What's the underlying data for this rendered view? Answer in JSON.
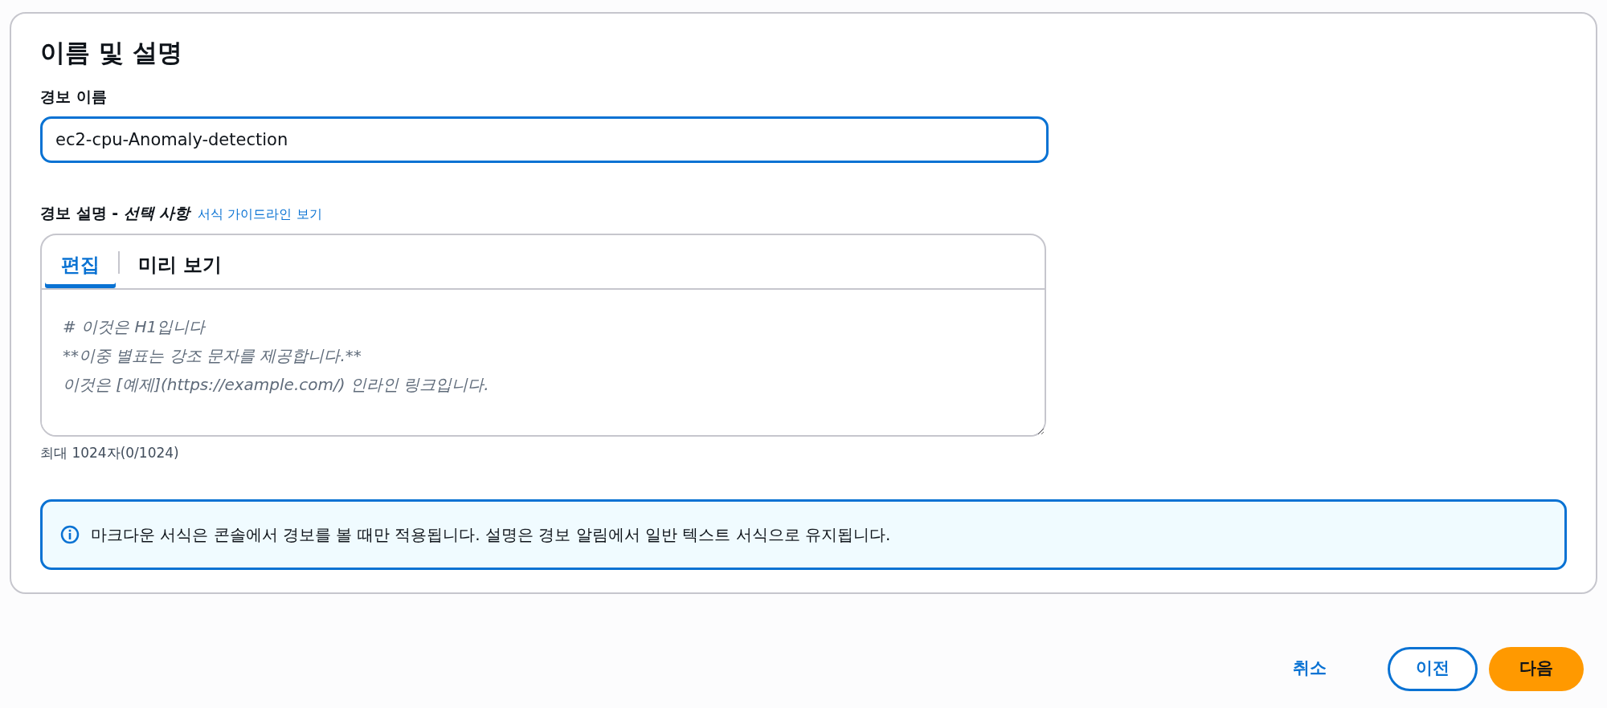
{
  "panel": {
    "title": "이름 및 설명"
  },
  "alarm_name": {
    "label": "경보 이름",
    "value": "ec2-cpu-Anomaly-detection"
  },
  "alarm_description": {
    "label": "경보 설명 - ",
    "optional": "선택 사항",
    "link": "서식 가이드라인 보기",
    "tabs": [
      {
        "label": "편집",
        "selected": true
      },
      {
        "label": "미리 보기",
        "selected": false
      }
    ],
    "placeholder": "# 이것은 H1입니다\n**이중 별표는 강조 문자를 제공합니다.**\n이것은 [예제](https://example.com/) 인라인 링크입니다.",
    "hint": "최대 1024자(0/1024)"
  },
  "info": {
    "text": "마크다운 서식은 콘솔에서 경보를 볼 때만 적용됩니다. 설명은 경보 알림에서 일반 텍스트 서식으로 유지됩니다."
  },
  "buttons": [
    {
      "label": "취소",
      "kind": "link"
    },
    {
      "label": "이전",
      "kind": "secondary"
    },
    {
      "label": "다음",
      "kind": "primary"
    }
  ]
}
